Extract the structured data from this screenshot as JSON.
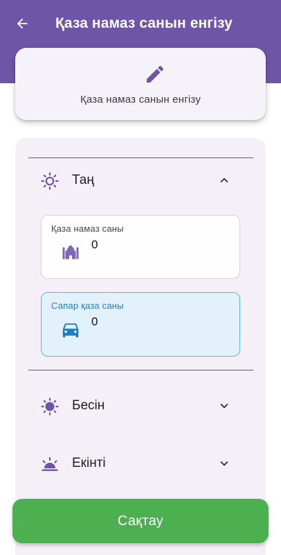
{
  "appbar": {
    "title": "Қаза намаз санын енгізу",
    "back_icon": "arrow-left-icon"
  },
  "header_card": {
    "icon": "pencil-icon",
    "subtitle": "Қаза намаз санын енгізу"
  },
  "sections": [
    {
      "label": "Таң",
      "icon": "sun-outline-icon",
      "expanded": true,
      "fields": {
        "qaza": {
          "label": "Қаза намаз саны",
          "value": "0",
          "icon": "mosque-icon"
        },
        "safar": {
          "label": "Сапар қаза саны",
          "value": "0",
          "icon": "car-icon"
        }
      }
    },
    {
      "label": "Бесін",
      "icon": "sun-filled-icon",
      "expanded": false
    },
    {
      "label": "Екінті",
      "icon": "sunset-icon",
      "expanded": false
    }
  ],
  "save_button": {
    "label": "Сақтау"
  },
  "colors": {
    "primary": "#6f55a6",
    "panel": "#f5f0f8",
    "save": "#4caf50",
    "safar_bg": "#e2f1fc",
    "safar_accent": "#1f7ebd"
  }
}
